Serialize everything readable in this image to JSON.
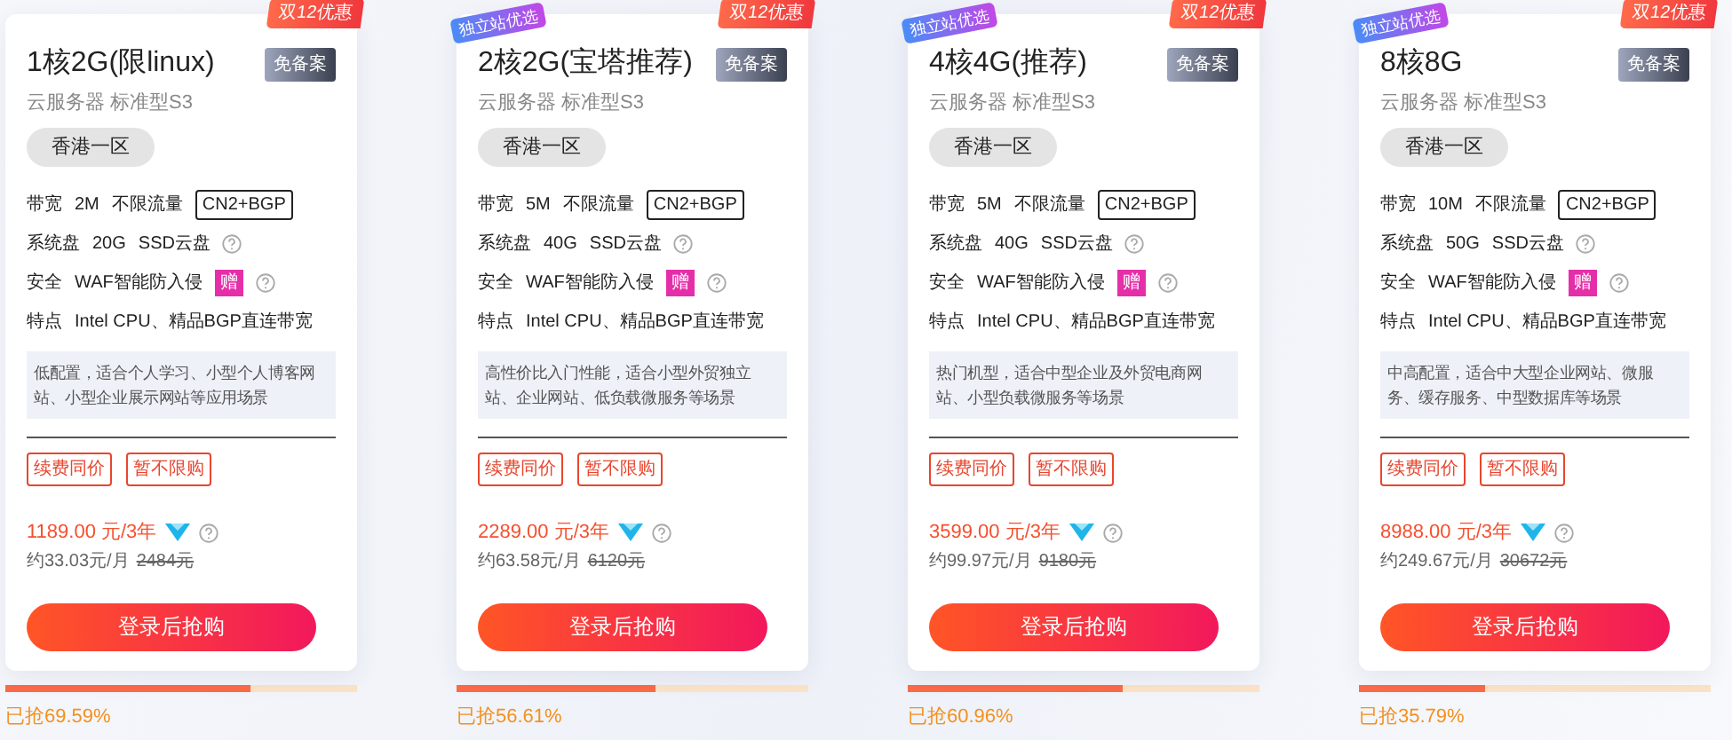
{
  "plans": [
    {
      "title": "1核2G(限linux)",
      "promo": "双12优惠",
      "beian": "免备案",
      "subtitle": "云服务器 标准型S3",
      "region": "香港一区",
      "specs": [
        {
          "kind": "tagged",
          "label": "带宽",
          "values": [
            "2M",
            "不限流量"
          ],
          "tag": "CN2+BGP"
        },
        {
          "kind": "help",
          "label": "系统盘",
          "values": [
            "20G",
            "SSD云盘"
          ]
        },
        {
          "kind": "gift",
          "label": "安全",
          "values": [
            "WAF智能防入侵"
          ],
          "tag": "赠"
        },
        {
          "kind": "plain",
          "label": "特点",
          "values": [
            "Intel CPU、精品BGP直连带宽"
          ]
        }
      ],
      "description": "低配置，适合个人学习、小型个人博客网站、小型企业展示网站等应用场景",
      "tags": [
        "续费同价",
        "暂不限购"
      ],
      "price": "1189.00 元/3年",
      "monthly": "约33.03元/月",
      "original": "2484元",
      "button": "登录后抢购",
      "level": 0.6959,
      "sold": "已抢69.59%"
    },
    {
      "title": "2核2G(宝塔推荐)",
      "ribbon": "独立站优选",
      "promo": "双12优惠",
      "beian": "免备案",
      "subtitle": "云服务器 标准型S3",
      "region": "香港一区",
      "specs": [
        {
          "kind": "tagged",
          "label": "带宽",
          "values": [
            "5M",
            "不限流量"
          ],
          "tag": "CN2+BGP"
        },
        {
          "kind": "help",
          "label": "系统盘",
          "values": [
            "40G",
            "SSD云盘"
          ]
        },
        {
          "kind": "gift",
          "label": "安全",
          "values": [
            "WAF智能防入侵"
          ],
          "tag": "赠"
        },
        {
          "kind": "plain",
          "label": "特点",
          "values": [
            "Intel CPU、精品BGP直连带宽"
          ]
        }
      ],
      "description": "高性价比入门性能，适合小型外贸独立站、企业网站、低负载微服务等场景",
      "tags": [
        "续费同价",
        "暂不限购"
      ],
      "price": "2289.00 元/3年",
      "monthly": "约63.58元/月",
      "original": "6120元",
      "button": "登录后抢购",
      "level": 0.5661,
      "sold": "已抢56.61%"
    },
    {
      "title": "4核4G(推荐)",
      "ribbon": "独立站优选",
      "promo": "双12优惠",
      "beian": "免备案",
      "subtitle": "云服务器 标准型S3",
      "region": "香港一区",
      "specs": [
        {
          "kind": "tagged",
          "label": "带宽",
          "values": [
            "5M",
            "不限流量"
          ],
          "tag": "CN2+BGP"
        },
        {
          "kind": "help",
          "label": "系统盘",
          "values": [
            "40G",
            "SSD云盘"
          ]
        },
        {
          "kind": "gift",
          "label": "安全",
          "values": [
            "WAF智能防入侵"
          ],
          "tag": "赠"
        },
        {
          "kind": "plain",
          "label": "特点",
          "values": [
            "Intel CPU、精品BGP直连带宽"
          ]
        }
      ],
      "description": "热门机型，适合中型企业及外贸电商网站、小型负载微服务等场景",
      "tags": [
        "续费同价",
        "暂不限购"
      ],
      "price": "3599.00 元/3年",
      "monthly": "约99.97元/月",
      "original": "9180元",
      "button": "登录后抢购",
      "level": 0.6096,
      "sold": "已抢60.96%"
    },
    {
      "title": "8核8G",
      "ribbon": "独立站优选",
      "promo": "双12优惠",
      "beian": "免备案",
      "subtitle": "云服务器 标准型S3",
      "region": "香港一区",
      "specs": [
        {
          "kind": "tagged",
          "label": "带宽",
          "values": [
            "10M",
            "不限流量"
          ],
          "tag": "CN2+BGP"
        },
        {
          "kind": "help",
          "label": "系统盘",
          "values": [
            "50G",
            "SSD云盘"
          ]
        },
        {
          "kind": "gift",
          "label": "安全",
          "values": [
            "WAF智能防入侵"
          ],
          "tag": "赠"
        },
        {
          "kind": "plain",
          "label": "特点",
          "values": [
            "Intel CPU、精品BGP直连带宽"
          ]
        }
      ],
      "description": "中高配置，适合中大型企业网站、微服务、缓存服务、中型数据库等场景",
      "tags": [
        "续费同价",
        "暂不限购"
      ],
      "price": "8988.00 元/3年",
      "monthly": "约249.67元/月",
      "original": "30672元",
      "button": "登录后抢购",
      "level": 0.3579,
      "sold": "已抢35.79%"
    }
  ]
}
